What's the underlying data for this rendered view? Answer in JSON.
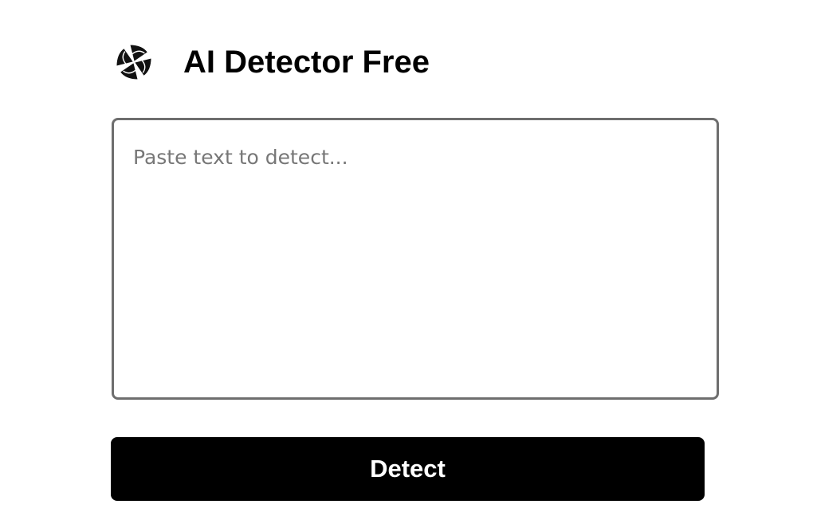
{
  "header": {
    "logo_icon": "swirl-logo-icon",
    "title": "AI Detector Free"
  },
  "input": {
    "value": "",
    "placeholder": "Paste text to detect..."
  },
  "actions": {
    "detect_label": "Detect"
  },
  "colors": {
    "button_background": "#000000",
    "button_text": "#ffffff",
    "textarea_border": "#6e6e6e",
    "placeholder_text": "#777777"
  }
}
